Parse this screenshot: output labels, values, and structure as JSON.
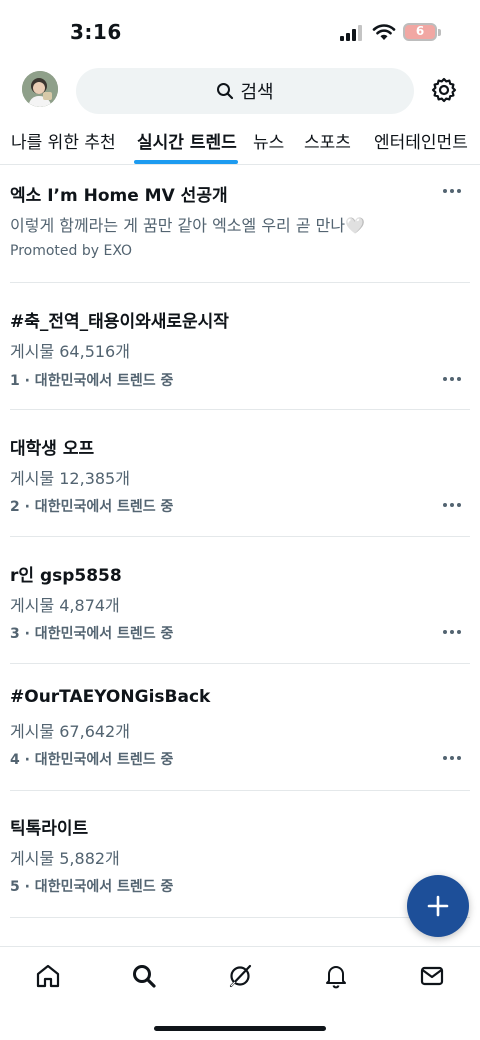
{
  "status_bar": {
    "time": "3:16",
    "battery": "6"
  },
  "header": {
    "search_placeholder": "검색"
  },
  "tabs": [
    {
      "label": "나를 위한 추천",
      "active": false
    },
    {
      "label": "실시간 트렌드",
      "active": true
    },
    {
      "label": "뉴스",
      "active": false
    },
    {
      "label": "스포츠",
      "active": false
    },
    {
      "label": "엔터테인먼트",
      "active": false
    }
  ],
  "promoted": {
    "title": "엑소 I’m Home MV 선공개",
    "subtitle": "이렇게 함께라는 게 꿈만 같아 엑소엘 우리 곧 만나🤍",
    "promoted_by": "Promoted by EXO"
  },
  "trends": [
    {
      "title": "#축_전역_태용이와새로운시작",
      "posts": "게시물 64,516개",
      "context": "1 · 대한민국에서 트렌드 중"
    },
    {
      "title": "대학생 오프",
      "posts": "게시물 12,385개",
      "context": "2 · 대한민국에서 트렌드 중"
    },
    {
      "title": "r인 gsp5858",
      "posts": "게시물 4,874개",
      "context": "3 · 대한민국에서 트렌드 중"
    },
    {
      "title": "#OurTAEYONGisBack",
      "posts": "게시물 67,642개",
      "context": "4 · 대한민국에서 트렌드 중"
    },
    {
      "title": "틱톡라이트",
      "posts": "게시물 5,882개",
      "context": "5 · 대한민국에서 트렌드 중"
    }
  ],
  "colors": {
    "accent": "#1d9bf0",
    "fab": "#1d4f99",
    "secondary_text": "#536471"
  }
}
